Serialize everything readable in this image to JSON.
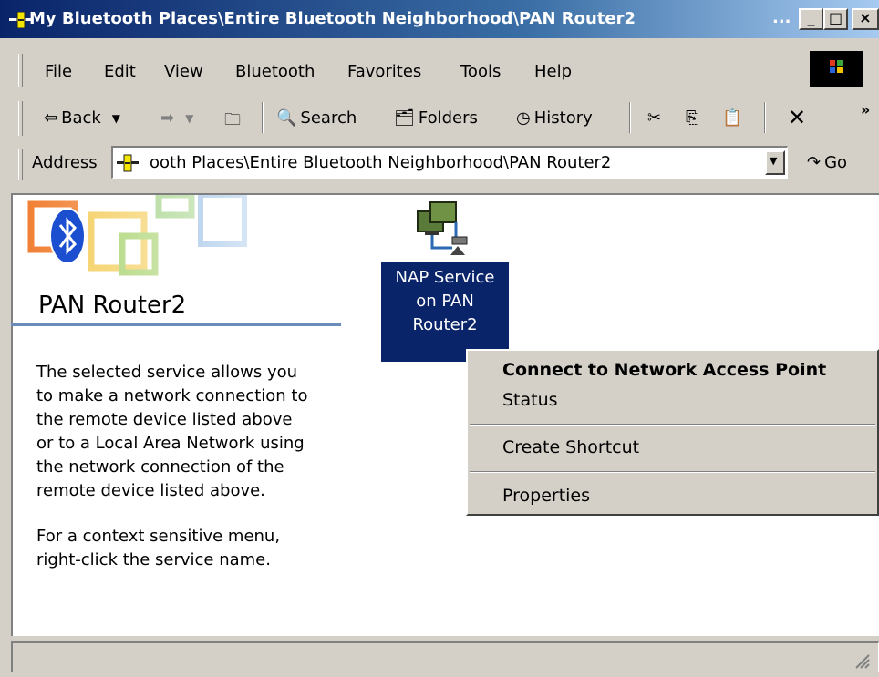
{
  "window": {
    "title": "My Bluetooth Places\\Entire Bluetooth Neighborhood\\PAN Router2",
    "title_ellipsis": "...",
    "minimize_glyph": "_",
    "maximize_glyph": "□",
    "close_glyph": "×"
  },
  "menu": [
    "File",
    "Edit",
    "View",
    "Bluetooth",
    "Favorites",
    "Tools",
    "Help"
  ],
  "toolbar": {
    "back": "Back",
    "search": "Search",
    "folders": "Folders",
    "history": "History",
    "more": "»"
  },
  "address": {
    "label": "Address",
    "value": "ooth Places\\Entire Bluetooth Neighborhood\\PAN Router2",
    "go": "Go"
  },
  "left_panel": {
    "device_name": "PAN Router2",
    "description_lines": [
      "The selected service allows you",
      "to make a network connection to",
      "the remote device listed above",
      "or to a Local Area Network using",
      "the network connection of the",
      "remote device listed above."
    ],
    "hint_lines": [
      "For a context sensitive menu,",
      "right-click the service name."
    ]
  },
  "service_item": {
    "label_lines": [
      "NAP Service",
      "on PAN",
      "Router2"
    ]
  },
  "context_menu": {
    "items": [
      "Connect to Network Access Point",
      "Status",
      "Create Shortcut",
      "Properties"
    ]
  },
  "colors": {
    "title_start": "#0a246a",
    "title_end": "#a6caf0",
    "selection": "#0a246a",
    "face": "#d4d0c8"
  }
}
